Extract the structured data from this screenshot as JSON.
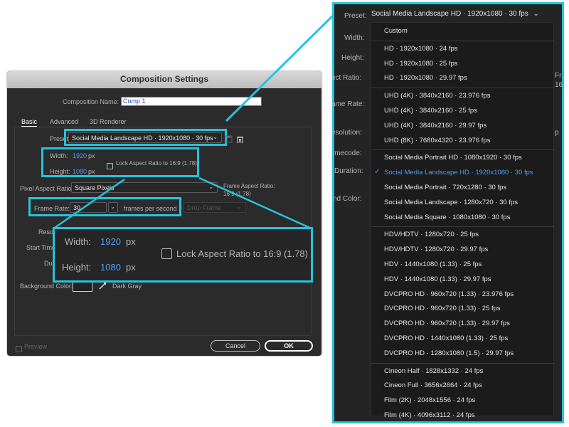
{
  "dialog": {
    "title": "Composition Settings",
    "comp_name_label": "Composition Name:",
    "comp_name_value": "Comp 1",
    "tabs": [
      "Basic",
      "Advanced",
      "3D Renderer"
    ],
    "preset_label": "Preset:",
    "preset_value": "Social Media Landscape HD  ·  1920x1080 · 30 fps",
    "width_label": "Width:",
    "width_value": "1920",
    "height_label": "Height:",
    "height_value": "1080",
    "unit": "px",
    "lock_label": "Lock Aspect Ratio to 16:9 (1.78)",
    "par_label": "Pixel Aspect Ratio:",
    "par_value": "Square Pixels",
    "far_label": "Frame Aspect Ratio:",
    "far_value": "16:9 (1.78)",
    "fr_label": "Frame Rate:",
    "fr_value": "30",
    "fr_unit": "frames per second",
    "drop_frame": "Drop Frame",
    "reso_label": "Resol",
    "start_label": "Start Time",
    "dur_label": "Du",
    "bg_label": "Background Color:",
    "bg_name": "Dark Gray",
    "preview_label": "Preview",
    "cancel": "Cancel",
    "ok": "OK"
  },
  "zoom": {
    "width_label": "Width:",
    "width_value": "1920",
    "height_label": "Height:",
    "height_value": "1080",
    "unit": "px",
    "lock_label": "Lock Aspect Ratio to 16:9 (1.78)"
  },
  "menu": {
    "preset_label": "Preset:",
    "preset_value": "Social Media Landscape HD  ·  1920x1080 · 30 fps",
    "side_labels": [
      "Width:",
      "Height:",
      "ect Ratio:",
      "ame Rate:",
      "esolution:",
      "imecode:",
      "Duration:",
      "nd Color:"
    ],
    "right_clip_1": "Fr",
    "right_clip_2": "16",
    "right_clip_3": "p",
    "items": [
      "Custom",
      "HD  ·  1920x1080 · 24 fps",
      "HD  ·  1920x1080 · 25 fps",
      "HD  ·  1920x1080 · 29.97 fps",
      "UHD (4K)  ·  3840x2160 · 23.976 fps",
      "UHD (4K)  ·  3840x2160 · 25 fps",
      "UHD (4K)  ·  3840x2160 · 29.97 fps",
      "UHD (8K)  ·  7680x4320 · 23.976 fps",
      "Social Media Portrait HD  ·  1080x1920 · 30 fps",
      "Social Media Landscape HD  ·  1920x1080 · 30 fps",
      "Social Media Portrait  ·  720x1280 · 30 fps",
      "Social Media Landscape  ·  1280x720 · 30 fps",
      "Social Media Square  ·  1080x1080 · 30 fps",
      "HDV/HDTV  ·  1280x720 · 25 fps",
      "HDV/HDTV  ·  1280x720 · 29.97 fps",
      "HDV  ·  1440x1080 (1.33) · 25 fps",
      "HDV  ·  1440x1080 (1.33) · 29.97 fps",
      "DVCPRO HD  ·  960x720 (1.33) · 23.976 fps",
      "DVCPRO HD  ·  960x720 (1.33) · 25 fps",
      "DVCPRO HD  ·  960x720 (1.33) · 29.97 fps",
      "DVCPRO HD  ·  1440x1080 (1.33) · 25 fps",
      "DVCPRO HD  ·  1280x1080 (1.5) · 29.97 fps",
      "Cineon Half  ·  1828x1332 · 24 fps",
      "Cineon Full  ·  3656x2664 · 24 fps",
      "Film (2K)  ·  2048x1556 · 24 fps",
      "Film (4K)  ·  4096x3112 · 24 fps"
    ],
    "selected_index": 9
  },
  "colors": {
    "highlight": "#28c2dc",
    "accent_blue": "#4f9df5",
    "dialog_bg": "#2b2b2b",
    "menu_bg": "#1b1b1b"
  }
}
